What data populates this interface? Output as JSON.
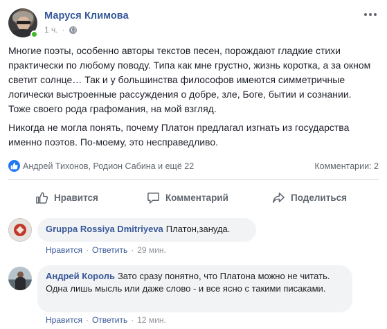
{
  "post": {
    "author": "Маруся Климова",
    "time": "1 ч.",
    "meta_separator": "·",
    "paragraphs": [
      "Многие поэты, особенно авторы текстов песен, порождают гладкие стихи практически по любому поводу. Типа как мне грустно, жизнь коротка, а за окном светит солнце… Так и у большинства философов имеются симметричные логически выстроенные рассуждения о добре, зле, Боге, бытии и сознании. Тоже своего рода графомания, на мой взгляд.",
      "Никогда не могла понять, почему Платон предлагал изгнать из государства именно поэтов. По-моему, это несправедливо."
    ],
    "reactions_names": "Андрей Тихонов, Родион Сабина и ещё 22",
    "comments_count": "Комментарии: 2"
  },
  "actions": {
    "like": "Нравится",
    "comment": "Комментарий",
    "share": "Поделиться"
  },
  "comments": [
    {
      "author": "Gruppa Rossiya Dmitriyeva",
      "text": "Платон,зануда.",
      "like": "Нравится",
      "reply": "Ответить",
      "time": "29 мин."
    },
    {
      "author": "Андрей Король",
      "text": "Зато сразу понятно, что Платона можно не читать. Одна лишь мысль или даже слово - и все ясно с такими писаками.",
      "like": "Нравится",
      "reply": "Ответить",
      "time": "12 мин."
    }
  ],
  "icons": {
    "more": "more-horizontal-icon",
    "privacy": "globe-icon",
    "reaction": "like-badge-icon",
    "like": "thumbs-up-icon",
    "comment": "speech-bubble-icon",
    "share": "share-arrow-icon"
  },
  "colors": {
    "link": "#365899",
    "accent": "#2078f4",
    "online": "#42b72a",
    "muted": "#606770",
    "bubble": "#f2f3f5"
  }
}
